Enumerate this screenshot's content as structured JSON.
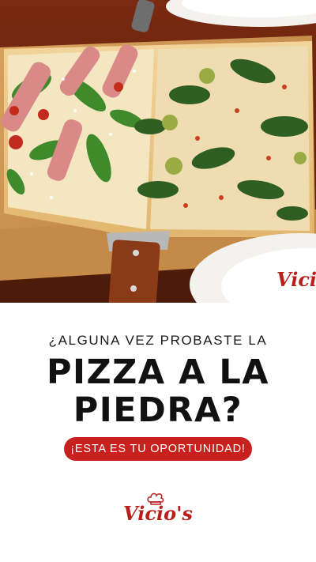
{
  "photo": {
    "plate_logo": "Vicio"
  },
  "headline": {
    "kicker": "¿ALGUNA VEZ PROBASTE LA",
    "line1": "PIZZA A LA",
    "line2": "PIEDRA?"
  },
  "cta": {
    "label": "¡ESTA ES TU OPORTUNIDAD!"
  },
  "brand": {
    "name": "Vicio's"
  },
  "colors": {
    "accent": "#c8201c",
    "text": "#111111",
    "background": "#ffffff"
  }
}
